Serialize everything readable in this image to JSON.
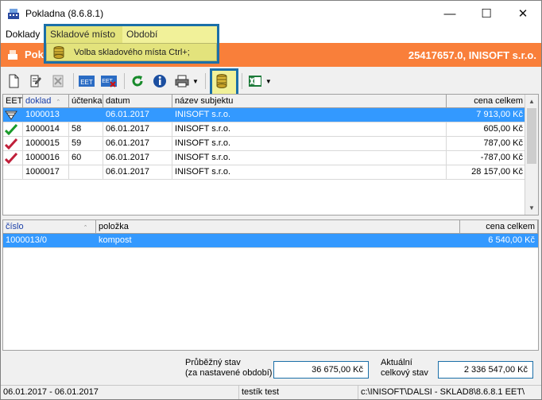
{
  "window": {
    "title": "Pokladna (8.6.8.1)",
    "controls": {
      "minimize": "—",
      "maximize": "☐",
      "close": "✕"
    }
  },
  "menubar": {
    "items": [
      "Doklady",
      "Skladové místo",
      "Období"
    ]
  },
  "dropdown": {
    "item_label": "Volba skladového místa Ctrl+;"
  },
  "header": {
    "title": "Poki",
    "right_text": "25417657.0, INISOFT s.r.o."
  },
  "toolbar": {
    "buttons": [
      "new-doc-icon",
      "edit-doc-icon",
      "delete-doc-icon",
      "eet-icon",
      "eet-cancel-icon",
      "refresh-icon",
      "info-icon",
      "print-icon",
      "database-icon",
      "excel-icon"
    ],
    "eet_label": "EET",
    "eet_cancel_label": "EET"
  },
  "top_grid": {
    "columns": [
      "EET",
      "doklad",
      "účtenka",
      "datum",
      "název subjektu",
      "cena celkem"
    ],
    "rows": [
      {
        "status": "eet-pending-icon",
        "doklad": "1000013",
        "uctenka": "",
        "datum": "06.01.2017",
        "nazev": "INISOFT s.r.o.",
        "cena": "7 913,00 Kč",
        "selected": true
      },
      {
        "status": "check-green-icon",
        "doklad": "1000014",
        "uctenka": "58",
        "datum": "06.01.2017",
        "nazev": "INISOFT s.r.o.",
        "cena": "605,00 Kč"
      },
      {
        "status": "check-red-icon",
        "doklad": "1000015",
        "uctenka": "59",
        "datum": "06.01.2017",
        "nazev": "INISOFT s.r.o.",
        "cena": "787,00 Kč"
      },
      {
        "status": "check-red-icon",
        "doklad": "1000016",
        "uctenka": "60",
        "datum": "06.01.2017",
        "nazev": "INISOFT s.r.o.",
        "cena": "-787,00 Kč"
      },
      {
        "status": "",
        "doklad": "1000017",
        "uctenka": "",
        "datum": "06.01.2017",
        "nazev": "INISOFT s.r.o.",
        "cena": "28 157,00 Kč"
      }
    ]
  },
  "bottom_grid": {
    "columns": [
      "číslo",
      "položka",
      "cena celkem"
    ],
    "rows": [
      {
        "cislo": "1000013/0",
        "polozka": "kompost",
        "cena": "6 540,00 Kč",
        "selected": true
      }
    ]
  },
  "totals": {
    "running_label_1": "Průběžný stav",
    "running_label_2": "(za nastavené období)",
    "running_value": "36 675,00 Kč",
    "current_label_1": "Aktuální",
    "current_label_2": "celkový stav",
    "current_value": "2 336 547,00 Kč"
  },
  "status": {
    "period": "06.01.2017 - 06.01.2017",
    "user": "testík test",
    "path": "c:\\INISOFT\\DALSI - SKLAD8\\8.6.8.1 EET\\"
  }
}
